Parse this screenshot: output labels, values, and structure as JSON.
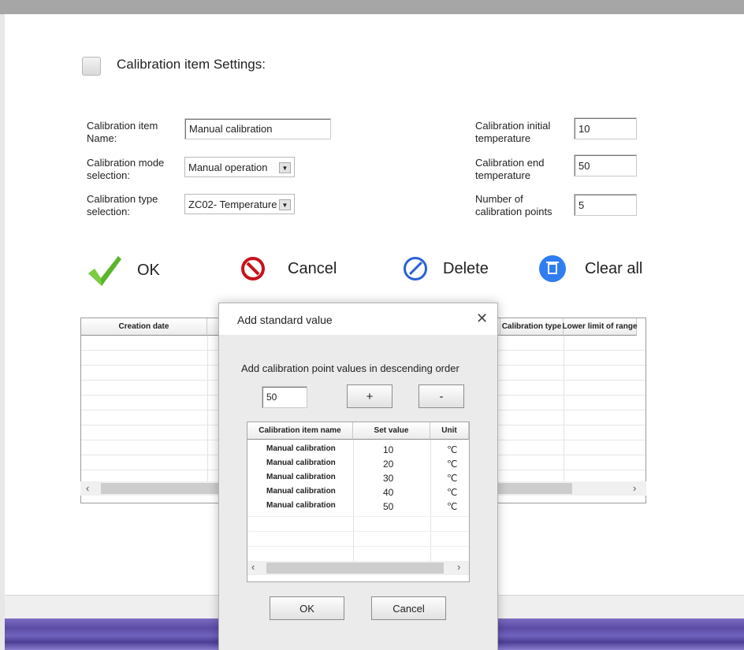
{
  "settings": {
    "heading": "Calibration item Settings:",
    "item_name_label": "Calibration item Name:",
    "item_name_value": "Manual calibration",
    "mode_label": "Calibration mode selection:",
    "mode_value": "Manual operation",
    "type_label": "Calibration type selection:",
    "type_value": "ZC02- Temperature",
    "init_temp_label": "Calibration initial temperature",
    "init_temp_value": "10",
    "end_temp_label": "Calibration end temperature",
    "end_temp_value": "50",
    "points_label": "Number of calibration points",
    "points_value": "5"
  },
  "actions": {
    "ok": "OK",
    "cancel": "Cancel",
    "delete": "Delete",
    "clear_all": "Clear all"
  },
  "main_table": {
    "columns": [
      "Creation date",
      "Calibration type",
      "Lower limit of range"
    ]
  },
  "dialog": {
    "title": "Add standard value",
    "instruction": "Add calibration point values in descending order",
    "input_value": "50",
    "plus": "+",
    "minus": "-",
    "columns": [
      "Calibration item name",
      "Set value",
      "Unit"
    ],
    "rows": [
      {
        "name": "Manual calibration",
        "value": "10",
        "unit": "℃"
      },
      {
        "name": "Manual calibration",
        "value": "20",
        "unit": "℃"
      },
      {
        "name": "Manual calibration",
        "value": "30",
        "unit": "℃"
      },
      {
        "name": "Manual calibration",
        "value": "40",
        "unit": "℃"
      },
      {
        "name": "Manual calibration",
        "value": "50",
        "unit": "℃"
      }
    ],
    "ok": "OK",
    "cancel": "Cancel"
  },
  "icons": {
    "ok": "checkmark-icon",
    "cancel": "no-entry-icon",
    "delete": "prohibited-icon",
    "clear_all": "trash-icon",
    "close": "close-icon"
  },
  "colors": {
    "check_green": "#5ab52b",
    "cancel_red": "#c8121c",
    "delete_blue": "#2a62d6",
    "clear_blue": "#2f7df0"
  }
}
